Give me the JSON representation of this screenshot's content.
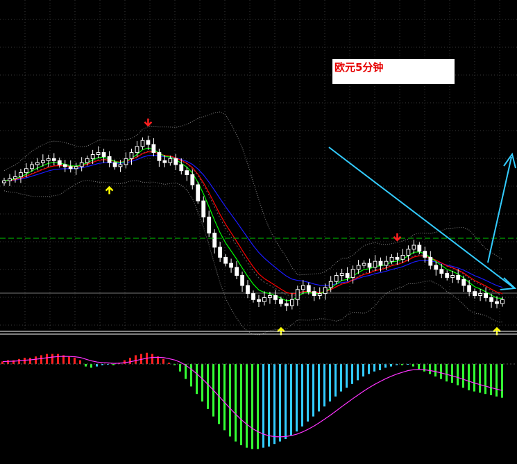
{
  "title_label": "欧元5分钟",
  "colors": {
    "background": "#000000",
    "grid": "#3a3a3a",
    "candle_up_fill": "#000000",
    "candle_outline": "#ffffff",
    "candle_down_fill": "#ffffff",
    "ma_fast": "#00ff00",
    "ma_mid": "#ff0000",
    "ma_slow": "#1a1aff",
    "bollinger": "#888888",
    "level_line": "#00cc00",
    "trend_arrow": "#33ccff",
    "signal_up": "#ffff00",
    "signal_down": "#ff2020",
    "macd_pos": "#ff2020",
    "macd_neg": "#33ff33",
    "macd_neg_weak": "#33ccff",
    "macd_signal": "#ff33ff"
  },
  "chart_data": {
    "type": "candlestick",
    "title": "欧元5分钟",
    "xlabel": "",
    "ylabel": "",
    "grid": true,
    "price_pane": {
      "indicators": [
        "moving-average-fast",
        "moving-average-mid",
        "moving-average-slow",
        "bollinger-bands"
      ],
      "close_path": [
        0.62,
        0.63,
        0.64,
        0.66,
        0.68,
        0.7,
        0.71,
        0.72,
        0.73,
        0.72,
        0.7,
        0.69,
        0.68,
        0.69,
        0.71,
        0.73,
        0.75,
        0.76,
        0.74,
        0.71,
        0.69,
        0.7,
        0.73,
        0.76,
        0.79,
        0.82,
        0.8,
        0.76,
        0.72,
        0.71,
        0.73,
        0.7,
        0.67,
        0.65,
        0.6,
        0.52,
        0.44,
        0.36,
        0.29,
        0.24,
        0.21,
        0.19,
        0.15,
        0.1,
        0.06,
        0.03,
        0.02,
        0.04,
        0.05,
        0.03,
        0.01,
        0.0,
        0.03,
        0.08,
        0.1,
        0.07,
        0.05,
        0.06,
        0.09,
        0.12,
        0.15,
        0.16,
        0.14,
        0.18,
        0.2,
        0.21,
        0.19,
        0.22,
        0.2,
        0.22,
        0.24,
        0.23,
        0.25,
        0.28,
        0.3,
        0.27,
        0.24,
        0.2,
        0.18,
        0.16,
        0.14,
        0.15,
        0.13,
        0.1,
        0.07,
        0.05,
        0.06,
        0.04,
        0.02,
        0.01,
        0.03
      ],
      "signals": [
        {
          "type": "buy",
          "bar": 19
        },
        {
          "type": "sell",
          "bar": 26
        },
        {
          "type": "buy",
          "bar": 50
        },
        {
          "type": "sell",
          "bar": 71
        },
        {
          "type": "buy",
          "bar": 89
        }
      ],
      "trendline": "descending",
      "forecast_arrow": "up"
    },
    "macd_pane": {
      "histogram": [
        0.2,
        0.3,
        0.3,
        0.4,
        0.5,
        0.5,
        0.6,
        0.7,
        0.8,
        0.8,
        0.8,
        0.7,
        0.6,
        0.5,
        0.3,
        -0.2,
        -0.3,
        -0.2,
        -0.1,
        0.0,
        -0.1,
        0.1,
        0.3,
        0.5,
        0.7,
        0.8,
        0.9,
        0.8,
        0.6,
        0.4,
        0.1,
        -0.1,
        -0.6,
        -1.2,
        -1.8,
        -2.4,
        -3.0,
        -3.6,
        -4.2,
        -4.8,
        -5.3,
        -5.8,
        -6.2,
        -6.5,
        -6.7,
        -6.8,
        -6.8,
        -6.7,
        -6.6,
        -6.4,
        -6.2,
        -6.0,
        -5.7,
        -5.4,
        -5.0,
        -4.6,
        -4.2,
        -3.8,
        -3.4,
        -3.0,
        -2.6,
        -2.2,
        -1.9,
        -1.6,
        -1.3,
        -1.0,
        -0.8,
        -0.6,
        -0.5,
        -0.3,
        -0.2,
        -0.1,
        -0.1,
        0.0,
        -0.2,
        -0.4,
        -0.6,
        -0.8,
        -1.0,
        -1.2,
        -1.4,
        -1.5,
        -1.7,
        -1.9,
        -2.1,
        -2.2,
        -2.3,
        -2.4,
        -2.5,
        -2.6,
        -2.7
      ],
      "signal_line": "smoothed"
    }
  }
}
